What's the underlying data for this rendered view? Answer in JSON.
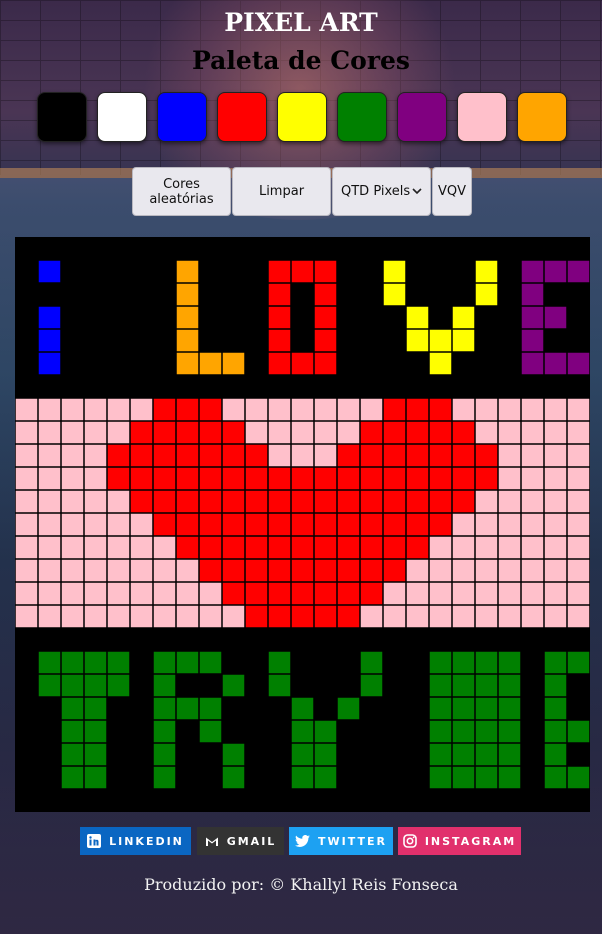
{
  "header": {
    "title": "PIXEL ART",
    "subtitle": "Paleta de Cores"
  },
  "palette": [
    "#000000",
    "#ffffff",
    "#0000ff",
    "#ff0000",
    "#ffff00",
    "#008000",
    "#800080",
    "#ffc0cb",
    "#ffa500"
  ],
  "controls": {
    "random_label": "Cores aleatórias",
    "clear_label": "Limpar",
    "qtd_label": "QTD Pixels",
    "vqv_label": "VQV"
  },
  "board": {
    "cols": 25,
    "rows": 25,
    "grid_color": "#000000",
    "cell_colors": {
      "K": "#000000",
      "B": "#0000ff",
      "O": "#ffa500",
      "R": "#ff0000",
      "Y": "#ffff00",
      "V": "#800080",
      "P": "#ffc0cb",
      "G": "#008000"
    },
    "pixels": [
      "KKKKKKKKKKKKKKKKKKKKKKKKK",
      "KBKKKKKOKKKRRRKKYKKKYKVVV",
      "KKKKKKKOKKKRKRKKYKKKYKVKK",
      "KBKKKKKOKKKRKRKKKYKYKKVVK",
      "KBKKKKKOKKKRKRKKKYYYKKVKK",
      "KBKKKKKOOOKRRRKKKKYKKKVVV",
      "KKKKKKKKKKKKKKKKKKKKKKKKK",
      "PPPPPPRRRPPPPPPPRRRPPPPPP",
      "PPPPPRRRRRPPPPPRRRRRPPPPP",
      "PPPPRRRRRRRPPPRRRRRRRPPPP",
      "PPPPRRRRRRRRRRRRRRRRRPPPP",
      "PPPPPRRRRRRRRRRRRRRRPPPPP",
      "PPPPPPRRRRRRRRRRRRRPPPPPP",
      "PPPPPPPRRRRRRRRRRRPPPPPPP",
      "PPPPPPPPRRRRRRRRRPPPPPPPP",
      "PPPPPPPPPRRRRRRRPPPPPPPPP",
      "PPPPPPPPPPRRRRRPPPPPPPPPP",
      "KKKKKKKKKKKKKKKKKKKKKKKKK",
      "KGGGGKGGGKKGKKKGKKGGGGKGGG",
      "KGGGGKGKKGKGKKKGKKGGGGKGKK",
      "KKGGKKGGGKKKGKGKKKGGGGKGKK",
      "KKGGKKGKGKKKGGKKKKGGGGKGGK",
      "KKGGKKGKKGKKGGKKKKGGGGKGKK",
      "KKGGKKGKKGKKGGKKKKGGGGKGGG",
      "KKKKKKKKKKKKKKKKKKKKKKKKK"
    ]
  },
  "social": {
    "linkedin": "LINKEDIN",
    "gmail": "GMAIL",
    "twitter": "TWITTER",
    "instagram": "INSTAGRAM",
    "icons": [
      "linkedin-icon",
      "gmail-icon",
      "twitter-icon",
      "instagram-icon"
    ]
  },
  "footer": {
    "credit": "Produzido por: © Khallyl Reis Fonseca"
  }
}
